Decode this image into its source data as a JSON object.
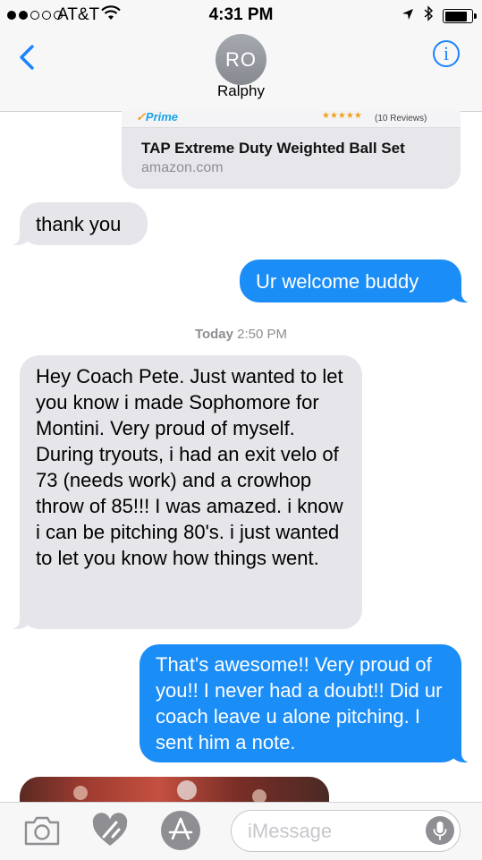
{
  "status_bar": {
    "carrier": "AT&T",
    "time": "4:31 PM",
    "signal_filled": 2,
    "signal_total": 5,
    "battery_level": 0.85
  },
  "header": {
    "avatar_initials": "RO",
    "contact_name": "Ralphy",
    "info_label": "i"
  },
  "link_preview": {
    "prime_label": "Prime",
    "stars": "★★★★★",
    "reviews": "(10 Reviews)",
    "title": "TAP Extreme Duty Weighted Ball Set",
    "domain": "amazon.com"
  },
  "messages": [
    {
      "direction": "in",
      "text": "thank you"
    },
    {
      "direction": "out",
      "text": "Ur welcome buddy"
    },
    {
      "direction": "in",
      "text": "Hey Coach Pete. Just wanted to let you know i made Sophomore for Montini. Very proud of myself. During tryouts, i had an exit velo of 73 (needs work) and a crowhop throw of 85!!! I was amazed. i know i can be pitching 80's. i just wanted to let you know how things went."
    },
    {
      "direction": "out",
      "text": "That's awesome!! Very proud of you!! I never had a doubt!! Did ur coach leave u alone pitching. I sent him a note."
    }
  ],
  "timestamp": {
    "day": "Today",
    "time": "2:50 PM"
  },
  "input_bar": {
    "placeholder": "iMessage",
    "icons": [
      "camera-icon",
      "digital-touch-icon",
      "app-store-icon",
      "microphone-icon"
    ]
  },
  "colors": {
    "accent_blue": "#1a84ff",
    "outgoing_bubble": "#1b8df7",
    "incoming_bubble": "#e5e5ea"
  }
}
